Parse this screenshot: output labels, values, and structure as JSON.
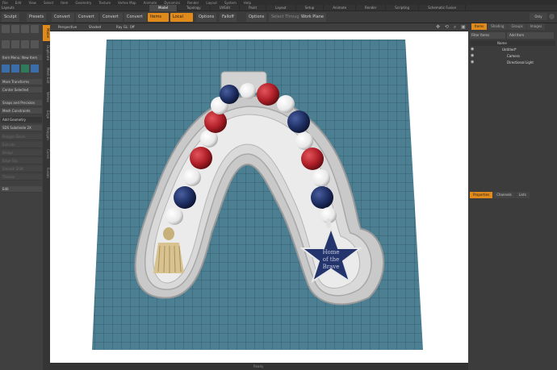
{
  "menubar": [
    "File",
    "Edit",
    "View",
    "Select",
    "Item",
    "Geometry",
    "Texture",
    "Vertex Map",
    "Animate",
    "Dynamics",
    "Render",
    "Layout",
    "System",
    "Help"
  ],
  "layout_label": "Layouts",
  "layout_tabs": [
    "Model",
    "Topology",
    "UVEdit",
    "Paint",
    "Layout",
    "Setup",
    "Animate",
    "Render",
    "Scripting",
    "Schematic Fusion"
  ],
  "toolbar": {
    "sculpt": "Sculpt",
    "presets": "Presets",
    "convert1": "Convert",
    "convert2": "Convert",
    "convert3": "Convert",
    "convert4": "Convert",
    "items": "Items",
    "local": "Local",
    "options": "Options",
    "falloff": "Falloff",
    "options2": "Options",
    "select_through": "Select Through",
    "work_plane": "Work Plane",
    "only": "Only"
  },
  "left_panel": {
    "dropdown1": "Item Menu: New Item",
    "more_transforms": "More Transforms",
    "center_selected": "Center Selected",
    "snaps": "Snaps and Precision",
    "mesh_constraints": "Mesh Constraints",
    "add_geometry": "Add Geometry",
    "sds_subdivide": "SDS Subdivide 2X",
    "dim_items": [
      "Polygon Bevel",
      "Extrude",
      "Bridge",
      "Edge Slip",
      "Smooth Shift",
      "Thicken"
    ],
    "edit": "Edit"
  },
  "vertical_tabs": [
    "Model",
    "Duplicate",
    "Mesh Edit",
    "Vertex",
    "Edge",
    "Polygon",
    "Curve",
    "Fusion"
  ],
  "viewport_header": {
    "perspective": "Perspective",
    "shaded": "Shaded",
    "ray_gl": "Ray GL: Off"
  },
  "star_text": [
    "Home",
    "of the",
    "Brave"
  ],
  "status_text": "Ready",
  "right_panel": {
    "tabs": [
      "Items",
      "Shading",
      "Groups",
      "Images"
    ],
    "filter": "Filter Items",
    "add_item": "Add Item",
    "name_col": "Name",
    "items": [
      "Untitled*",
      "Camera",
      "Directional Light"
    ],
    "bottom_tabs": [
      "Properties",
      "Channels",
      "Lists"
    ]
  },
  "colors": {
    "accent": "#e08a1c",
    "grid_bg": "#4d7f93",
    "bead_red": "#b01f28",
    "bead_blue": "#1e2f63",
    "bead_white": "#f2f2f2",
    "star_blue": "#24356e",
    "tassel": "#c8b07a"
  }
}
